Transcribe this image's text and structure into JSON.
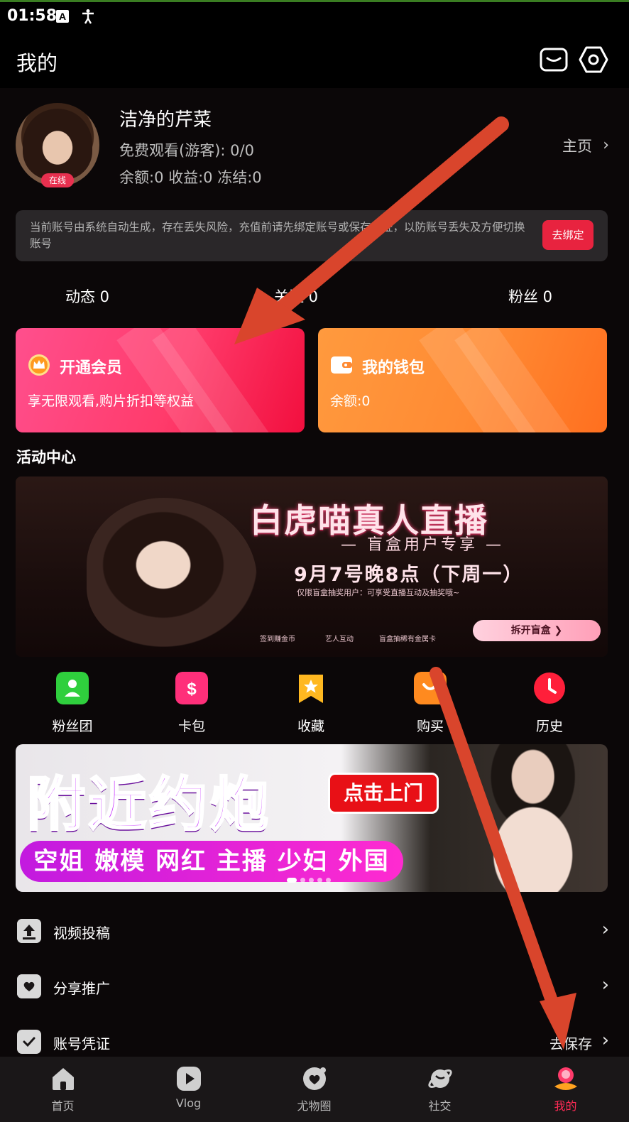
{
  "status_bar": {
    "time": "01:58"
  },
  "header": {
    "title": "我的"
  },
  "profile": {
    "name": "洁净的芹菜",
    "line1": "免费观看(游客): 0/0",
    "line2": "余额:0 收益:0 冻结:0",
    "online_badge": "在线",
    "home_link": "主页",
    "home_chevron": "›"
  },
  "notice": {
    "text": "当前账号由系统自动生成，存在丢失风险，充值前请先绑定账号或保存凭证，以防账号丢失及方便切换账号",
    "button": "去绑定"
  },
  "stats": {
    "posts": "动态  0",
    "following": "关注  0",
    "fans": "粉丝  0"
  },
  "cards": {
    "vip": {
      "title": "开通会员",
      "subtitle": "享无限观看,购片折扣等权益"
    },
    "wallet": {
      "title": "我的钱包",
      "subtitle": "余额:0"
    }
  },
  "activity": {
    "section_title": "活动中心",
    "banner1": {
      "title": "白虎喵真人直播",
      "subtitle": "— 盲盒用户专享 —",
      "date": "9月7号晚8点（下周一）",
      "fine_print": "仅限盲盒抽奖用户：可享受直播互动及抽奖哦~",
      "feature1": "签到赚金币",
      "feature2": "艺人互动",
      "feature3": "盲盒抽稀有金属卡",
      "button": "拆开盲盒 ❯"
    }
  },
  "quick_actions": [
    {
      "label": "粉丝团",
      "color": "#2fcf3d"
    },
    {
      "label": "卡包",
      "color": "#ff2f7a"
    },
    {
      "label": "收藏",
      "color": "#ffb820"
    },
    {
      "label": "购买",
      "color": "#ff8a1f"
    },
    {
      "label": "历史",
      "color": "#ff1f3a"
    }
  ],
  "banner2": {
    "headline": "附近约炮",
    "button": "点击上门",
    "tags": "空姐 嫩模 网红 主播 少妇 外国"
  },
  "menu": [
    {
      "label": "视频投稿",
      "right": "",
      "chevron": "›"
    },
    {
      "label": "分享推广",
      "right": "",
      "chevron": "›"
    },
    {
      "label": "账号凭证",
      "right": "去保存",
      "chevron": "›"
    }
  ],
  "tabs": [
    {
      "label": "首页",
      "icon": "home-icon"
    },
    {
      "label": "Vlog",
      "icon": "play-icon"
    },
    {
      "label": "尤物圈",
      "icon": "heart-bubble-icon"
    },
    {
      "label": "社交",
      "icon": "planet-icon"
    },
    {
      "label": "我的",
      "icon": "profile-icon"
    }
  ],
  "colors": {
    "accent": "#ff2b55",
    "vip_card": "#ff3b6b",
    "wallet_card": "#ff8a33",
    "annotation_arrow": "#d9452c"
  }
}
